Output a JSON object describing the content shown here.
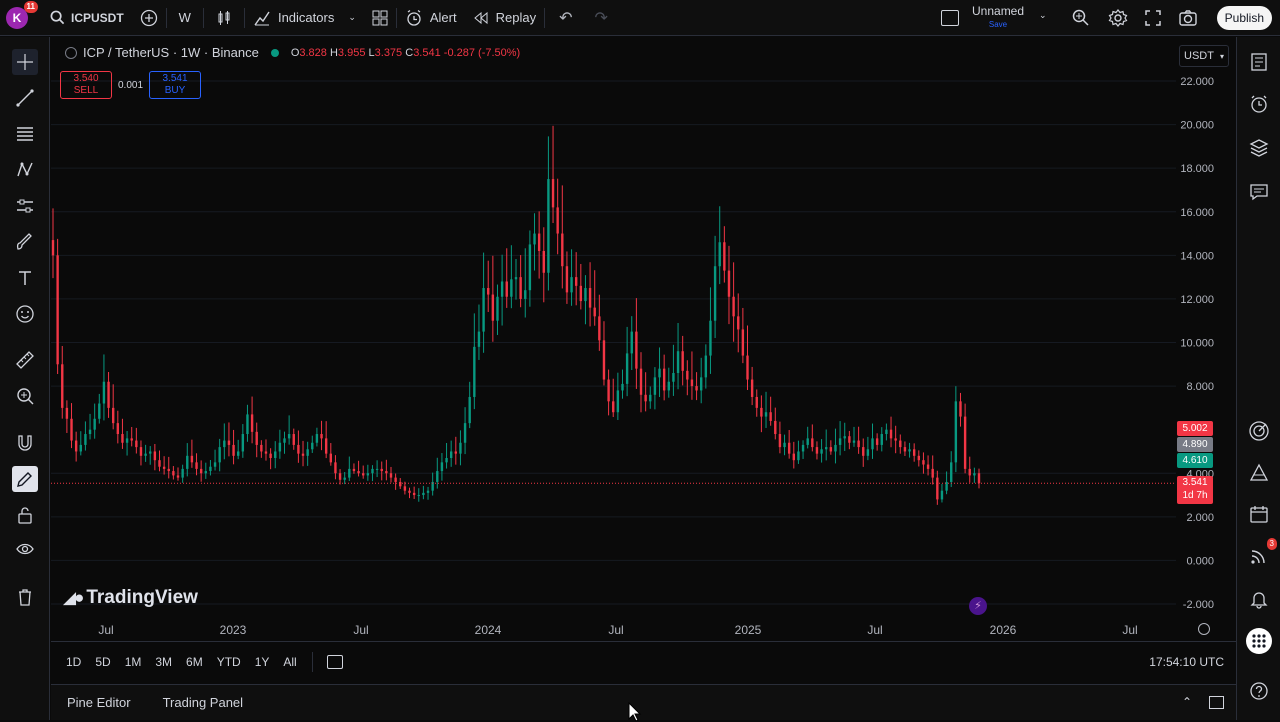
{
  "topbar": {
    "avatar_letter": "K",
    "notif_count": "11",
    "symbol": "ICPUSDT",
    "interval": "W",
    "indicators_label": "Indicators",
    "alert_label": "Alert",
    "replay_label": "Replay",
    "layout_name": "Unnamed",
    "layout_sub": "Save",
    "publish_label": "Publish"
  },
  "legend": {
    "title": "ICP / TetherUS · 1W · Binance",
    "o_label": "O",
    "o": "3.828",
    "h_label": "H",
    "h": "3.955",
    "l_label": "L",
    "l": "3.375",
    "c_label": "C",
    "c": "3.541",
    "change": "-0.287 (-7.50%)"
  },
  "trade": {
    "sell_price": "3.540",
    "sell_label": "SELL",
    "spread": "0.001",
    "buy_price": "3.541",
    "buy_label": "BUY"
  },
  "currency": "USDT",
  "watermark": "TradingView",
  "price_axis": [
    "22.000",
    "20.000",
    "18.000",
    "16.000",
    "14.000",
    "12.000",
    "10.000",
    "8.000",
    "4.000",
    "2.000",
    "0.000",
    "-2.000"
  ],
  "price_labels": [
    {
      "value": "5.002",
      "color": "#f23645"
    },
    {
      "value": "4.890",
      "color": "#787b86"
    },
    {
      "value": "4.610",
      "color": "#089981"
    },
    {
      "value": "3.541",
      "color": "#f23645"
    },
    {
      "value": "1d 7h",
      "color": "#f23645"
    }
  ],
  "time_axis": [
    "Jul",
    "2023",
    "Jul",
    "2024",
    "Jul",
    "2025",
    "Jul",
    "2026",
    "Jul"
  ],
  "ranges": [
    "1D",
    "5D",
    "1M",
    "3M",
    "6M",
    "YTD",
    "1Y",
    "All"
  ],
  "clock": "17:54:10 UTC",
  "panels": {
    "pine": "Pine Editor",
    "trading": "Trading Panel"
  },
  "rightbar_badge": "3",
  "chart_data": {
    "type": "candlestick",
    "symbol": "ICP / TetherUS",
    "interval": "1W",
    "exchange": "Binance",
    "ylim": [
      -2,
      22
    ],
    "last_close": 3.541,
    "closes": [
      14,
      9,
      7,
      6.5,
      5.5,
      5,
      5.3,
      5.8,
      6,
      6.5,
      7.2,
      8.2,
      7,
      6.3,
      5.8,
      5.4,
      5.6,
      5.5,
      5.2,
      4.8,
      4.9,
      5,
      4.6,
      4.3,
      4.2,
      4.1,
      3.9,
      3.8,
      4.2,
      4.8,
      4.5,
      4.2,
      4,
      4.1,
      4.3,
      4.5,
      5.2,
      5.5,
      5.3,
      4.8,
      5,
      5.8,
      6.7,
      5.9,
      5.3,
      5,
      4.9,
      4.7,
      5,
      5.4,
      5.6,
      5.8,
      5.3,
      4.9,
      4.8,
      5.1,
      5.4,
      5.8,
      5.6,
      4.9,
      4.5,
      4,
      3.7,
      3.8,
      4.2,
      4.1,
      4,
      3.9,
      4,
      4.2,
      4.2,
      4.1,
      4,
      3.8,
      3.6,
      3.4,
      3.2,
      3.1,
      3,
      3,
      3.1,
      3.2,
      3.6,
      4.1,
      4.5,
      4.7,
      5,
      4.9,
      5.4,
      6.3,
      7.5,
      9.8,
      10.5,
      12.5,
      12.2,
      11,
      12.1,
      12.8,
      12.1,
      12.9,
      13,
      12,
      12.4,
      14.5,
      15,
      14.2,
      13.2,
      17.5,
      16.2,
      15,
      13.5,
      12.3,
      13,
      12.6,
      11.9,
      12.5,
      11.6,
      11.2,
      10.1,
      8.3,
      7.3,
      6.8,
      7.8,
      8.1,
      9.5,
      10.5,
      8.8,
      7.6,
      7.3,
      7.6,
      8.4,
      8.8,
      7.8,
      8.2,
      8.6,
      9.6,
      8.7,
      8.3,
      8,
      7.8,
      8.4,
      9.4,
      11,
      13.5,
      14.6,
      13.3,
      12.1,
      11.2,
      10.6,
      9.4,
      8.3,
      7.5,
      7,
      6.6,
      6.8,
      6.4,
      5.8,
      5.2,
      5.4,
      4.9,
      4.6,
      5,
      5.3,
      5.6,
      5.2,
      4.9,
      5.1,
      5.2,
      5,
      5.3,
      5.6,
      5.7,
      5.4,
      5.5,
      5.2,
      4.8,
      5.1,
      5.6,
      5.3,
      5.8,
      6,
      5.6,
      5.5,
      5.2,
      5,
      5.1,
      4.8,
      4.6,
      4.4,
      4.2,
      3.8,
      2.8,
      3.2,
      3.6,
      4.5,
      7.3,
      6.6,
      4.2,
      3.9,
      4,
      3.541
    ]
  }
}
